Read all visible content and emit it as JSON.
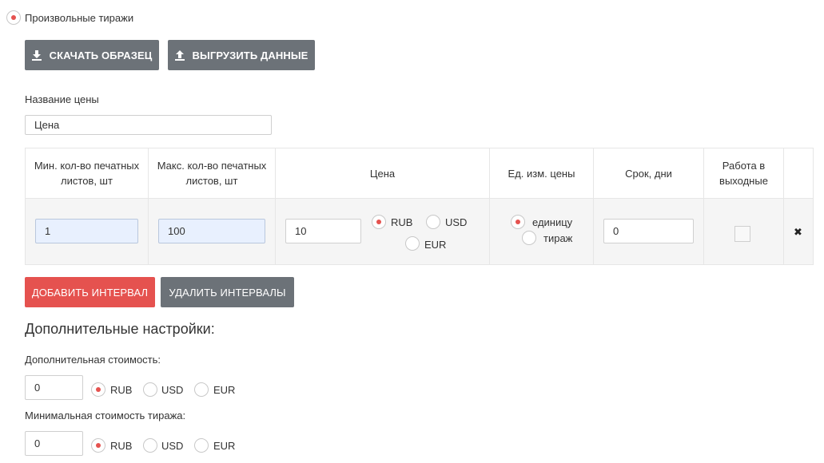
{
  "mode": {
    "label": "Произвольные тиражи",
    "selected": true
  },
  "toolbar": {
    "download_label": "СКАЧАТЬ ОБРАЗЕЦ",
    "upload_label": "ВЫГРУЗИТЬ ДАННЫЕ",
    "download_icon": "download-icon",
    "upload_icon": "upload-icon"
  },
  "price_name": {
    "label": "Название цены",
    "value": "Цена"
  },
  "table": {
    "headers": [
      "Мин. кол-во печатных листов, шт",
      "Макс. кол-во печатных листов, шт",
      "Цена",
      "Ед. изм. цены",
      "Срок, дни",
      "Работа в выходные",
      ""
    ],
    "rows": [
      {
        "min": "1",
        "max": "100",
        "price": "10",
        "currency_options": [
          "RUB",
          "USD",
          "EUR"
        ],
        "currency_selected": "RUB",
        "unit_options": [
          "единицу",
          "тираж"
        ],
        "unit_selected": "единицу",
        "days": "0",
        "weekends": false,
        "delete_icon": "close-icon",
        "delete_glyph": "✖"
      }
    ]
  },
  "actions": {
    "add_label": "ДОБАВИТЬ ИНТЕРВАЛ",
    "remove_label": "УДАЛИТЬ ИНТЕРВАЛЫ"
  },
  "extra": {
    "title": "Дополнительные настройки:",
    "additional_cost": {
      "label": "Дополнительная стоимость:",
      "value": "0",
      "currency_options": [
        "RUB",
        "USD",
        "EUR"
      ],
      "currency_selected": "RUB"
    },
    "min_cost": {
      "label": "Минимальная стоимость тиража:",
      "value": "0",
      "currency_options": [
        "RUB",
        "USD",
        "EUR"
      ],
      "currency_selected": "RUB"
    }
  },
  "colors": {
    "accent": "#e5524f",
    "button_gray": "#6c7278",
    "input_blue": "#e8f0fe"
  }
}
